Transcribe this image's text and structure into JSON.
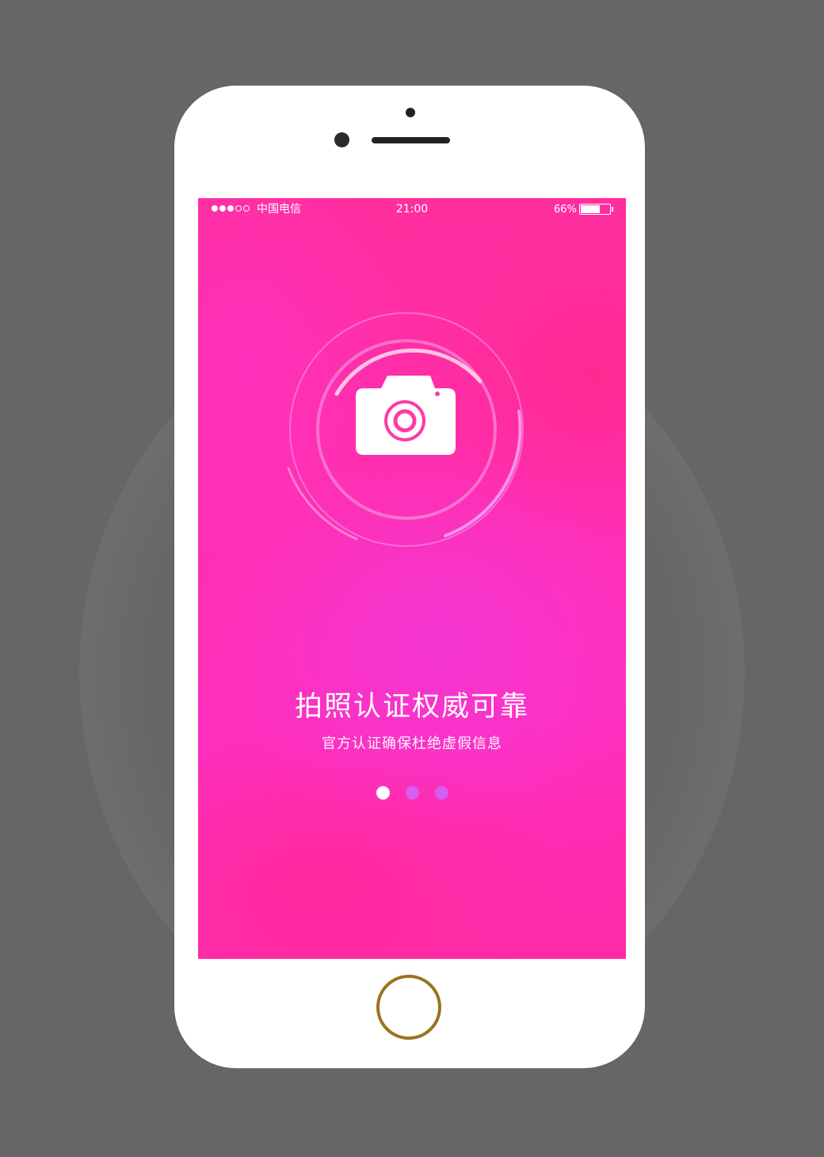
{
  "status_bar": {
    "signal_dots": [
      true,
      true,
      true,
      false,
      false
    ],
    "carrier": "中国电信",
    "time": "21:00",
    "battery_percent_label": "66%",
    "battery_level": 0.66
  },
  "onboarding": {
    "icon": "camera-icon",
    "headline": "拍照认证权威可靠",
    "subline": "官方认证确保杜绝虚假信息",
    "page_indicator": {
      "count": 3,
      "active_index": 0
    }
  },
  "colors": {
    "device_frame": "#ffffff",
    "background": "#666666",
    "screen_accent": "#ff2fb4",
    "home_ring": "#9a7320",
    "indicator_inactive": "#d75cf2"
  }
}
